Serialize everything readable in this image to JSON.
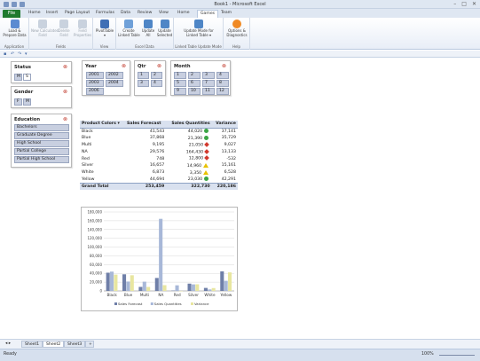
{
  "window": {
    "title": "Book1 - Microsoft Excel",
    "controls": [
      "–",
      "□",
      "✕"
    ]
  },
  "tabs": {
    "file": "File",
    "items": [
      "Home",
      "Insert",
      "Page Layout",
      "Formulas",
      "Data",
      "Review",
      "View",
      "Home",
      "Games",
      "Team"
    ],
    "active_index": 8
  },
  "ribbon": {
    "groups": [
      {
        "label": "Application",
        "buttons": [
          {
            "label": "Load &\nPrepare Data",
            "disabled": false,
            "color": "#5b8bd1"
          }
        ]
      },
      {
        "label": "Fields",
        "buttons": [
          {
            "label": "New Calculated\nField",
            "disabled": true,
            "color": "#c9d2de"
          },
          {
            "label": "Delete\nField",
            "disabled": true,
            "color": "#c9d2de"
          },
          {
            "label": "Field\nProperties",
            "disabled": true,
            "color": "#c9d2de"
          }
        ]
      },
      {
        "label": "View",
        "buttons": [
          {
            "label": "PivotTable\n▾",
            "disabled": false,
            "color": "#3f6fb5"
          }
        ]
      },
      {
        "label": "Excel Data",
        "buttons": [
          {
            "label": "Create\nLinked Table",
            "disabled": false,
            "color": "#6fa0d8"
          },
          {
            "label": "Update\nAll",
            "disabled": false,
            "color": "#4f86c6"
          },
          {
            "label": "Update\nSelected",
            "disabled": false,
            "color": "#4f86c6"
          }
        ]
      },
      {
        "label": "Linked Table Update Mode",
        "buttons": [
          {
            "label": "Update Mode for\nLinked Table ▾",
            "disabled": false,
            "color": "#4f86c6"
          }
        ]
      },
      {
        "label": "Help",
        "buttons": [
          {
            "label": "Options &\nDiagnostics",
            "disabled": false,
            "color": "#f08a24"
          }
        ]
      }
    ]
  },
  "slicers": {
    "status": {
      "title": "Status",
      "items": [
        "M",
        "S"
      ]
    },
    "gender": {
      "title": "Gender",
      "items": [
        "F",
        "M"
      ]
    },
    "education": {
      "title": "Education",
      "items": [
        "Bachelors",
        "Graduate Degree",
        "High School",
        "Partial College",
        "Partial High School"
      ]
    },
    "year": {
      "title": "Year",
      "items": [
        "2001",
        "2002",
        "2003",
        "2004",
        "2006"
      ]
    },
    "qtr": {
      "title": "Qtr",
      "items": [
        "1",
        "2",
        "3",
        "4"
      ]
    },
    "month": {
      "title": "Month",
      "items": [
        "1",
        "2",
        "3",
        "4",
        "5",
        "6",
        "7",
        "8",
        "9",
        "10",
        "11",
        "12"
      ]
    }
  },
  "pivot": {
    "headers": [
      "Product Colors",
      "Sales Forecast",
      "Sales Quantities",
      "Variance"
    ],
    "rows": [
      {
        "color": "Black",
        "forecast": "41,543",
        "quantity": "44,020",
        "kpi": "green",
        "variance": "37,141"
      },
      {
        "color": "Blue",
        "forecast": "37,868",
        "quantity": "21,390",
        "kpi": "green",
        "variance": "35,729"
      },
      {
        "color": "Multi",
        "forecast": "9,195",
        "quantity": "21,050",
        "kpi": "red",
        "variance": "9,027"
      },
      {
        "color": "NA",
        "forecast": "29,576",
        "quantity": "164,430",
        "kpi": "red",
        "variance": "13,133"
      },
      {
        "color": "Red",
        "forecast": "748",
        "quantity": "12,800",
        "kpi": "red",
        "variance": "-532"
      },
      {
        "color": "Silver",
        "forecast": "16,657",
        "quantity": "14,960",
        "kpi": "yellow",
        "variance": "15,161"
      },
      {
        "color": "White",
        "forecast": "6,873",
        "quantity": "3,350",
        "kpi": "yellow",
        "variance": "6,528"
      },
      {
        "color": "Yellow",
        "forecast": "44,694",
        "quantity": "23,030",
        "kpi": "green",
        "variance": "42,291"
      }
    ],
    "total": {
      "label": "Grand Total",
      "forecast": "253,459",
      "quantity": "322,730",
      "variance": "220,186"
    }
  },
  "chart_data": {
    "type": "bar",
    "categories": [
      "Black",
      "Blue",
      "Multi",
      "NA",
      "Red",
      "Silver",
      "White",
      "Yellow"
    ],
    "series": [
      {
        "name": "Sales Forecast",
        "color": "#6f7fa8",
        "values": [
          41543,
          37868,
          9195,
          29576,
          748,
          16657,
          6873,
          44694
        ]
      },
      {
        "name": "Sales Quantities",
        "color": "#a8b8d8",
        "values": [
          44020,
          21390,
          21050,
          164430,
          12800,
          14960,
          3350,
          23030
        ]
      },
      {
        "name": "Variance",
        "color": "#e8e6a0",
        "values": [
          37141,
          35729,
          9027,
          13133,
          -532,
          15161,
          6528,
          42291
        ]
      }
    ],
    "ylim": [
      0,
      180000
    ],
    "yticks": [
      "0",
      "20,000",
      "40,000",
      "60,000",
      "80,000",
      "100,000",
      "120,000",
      "140,000",
      "160,000",
      "180,000"
    ],
    "legend_position": "bottom"
  },
  "sheet_tabs": [
    "Sheet1",
    "Sheet2",
    "Sheet3"
  ],
  "active_sheet": 1,
  "status": {
    "ready": "Ready",
    "zoom": "100%"
  }
}
